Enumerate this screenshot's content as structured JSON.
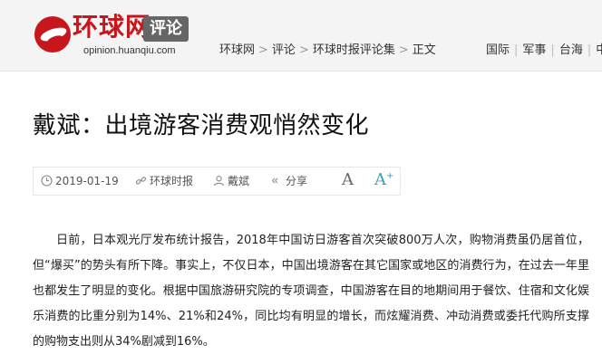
{
  "header": {
    "logo_text": "环球网",
    "section_badge": "评论",
    "site_url": "opinion.huanqiu.com",
    "breadcrumb": [
      "环球网",
      "评论",
      "环球时报评论集",
      "正文"
    ],
    "breadcrumb_separator": ">",
    "channels": [
      "国际",
      "军事",
      "台海",
      "中"
    ],
    "channel_separator": "|",
    "brand_color": "#c8161d"
  },
  "article": {
    "title": "戴斌：出境游客消费观悄然变化",
    "meta": {
      "date": "2019-01-19",
      "source": "环球时报",
      "author": "戴斌",
      "share_label": "分享",
      "font_small_label": "A",
      "font_large_label": "A",
      "font_large_plus": "+"
    },
    "paragraph": "日前，日本观光厅发布统计报告，2018年中国访日游客首次突破800万人次，购物消费虽仍居首位，但“爆买”的势头有所下降。事实上，不仅日本，中国出境游客在其它国家或地区的消费行为，在过去一年里也都发生了明显的变化。根据中国旅游研究院的专项调查，中国游客在目的地期间用于餐饮、住宿和文化娱乐消费的比重分别为14%、21%和24%，同比均有明显的增长，而炫耀消费、冲动消费或委托代购所支撑的购物支出则从34%剧减到16%。"
  },
  "icons": [
    "clock-icon",
    "link-icon",
    "user-icon",
    "share-icon",
    "font-decrease-icon",
    "font-increase-icon"
  ]
}
